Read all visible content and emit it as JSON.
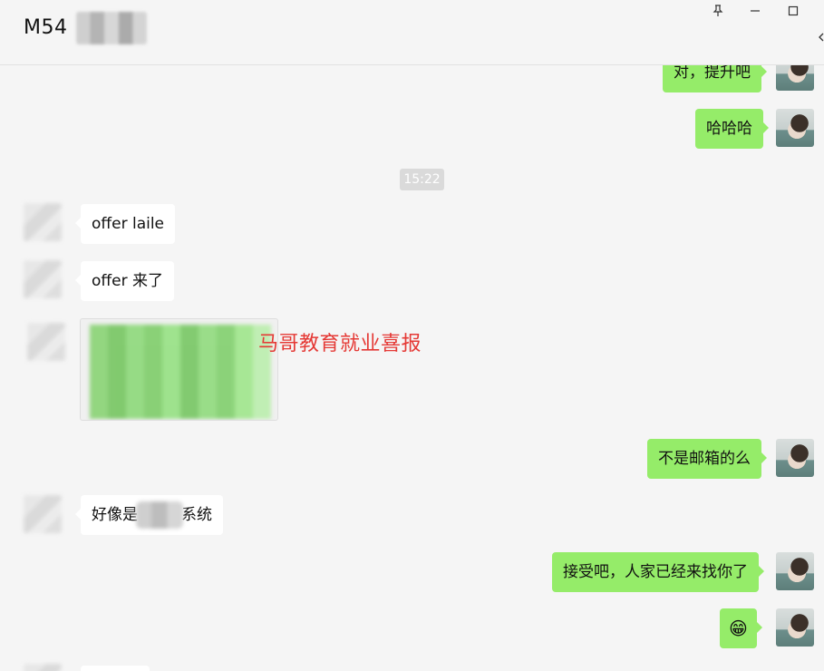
{
  "header": {
    "title": "M54"
  },
  "window_controls": {
    "pin": "pin-icon",
    "minimize": "minimize-icon",
    "maximize": "maximize-icon"
  },
  "messages": {
    "m1": "对，提升吧",
    "m2": "哈哈哈",
    "time": "15:22",
    "m3": "offer laile",
    "m4": "offer 来了",
    "image_caption": "马哥教育就业喜报",
    "m5": "不是邮箱的么",
    "m6_prefix": "好像是",
    "m6_suffix": "系统",
    "m7": "接受吧，人家已经来找你了",
    "m8": "😁"
  },
  "colors": {
    "self_bubble": "#95ec69",
    "other_bubble": "#ffffff",
    "caption": "#e53935",
    "background": "#f5f5f5"
  }
}
